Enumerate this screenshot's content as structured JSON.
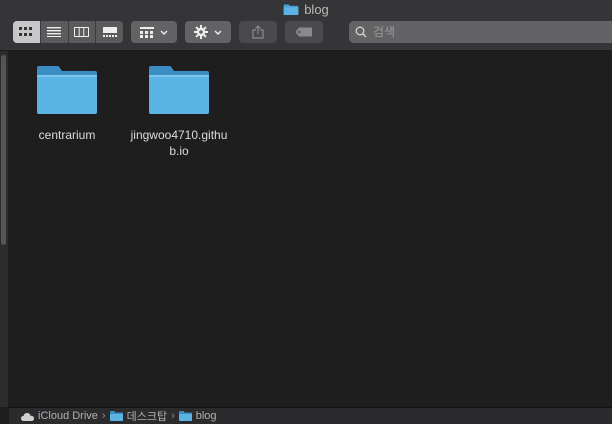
{
  "window": {
    "title": "blog"
  },
  "toolbar": {
    "search_placeholder": "검색"
  },
  "items": [
    {
      "name": "centrarium"
    },
    {
      "name": "jingwoo4710.github.io"
    }
  ],
  "path": [
    "iCloud Drive",
    "데스크탑",
    "blog"
  ],
  "colors": {
    "folder": "#5bb3e4",
    "background": "#1e1e1e",
    "toolbar": "#353537"
  }
}
